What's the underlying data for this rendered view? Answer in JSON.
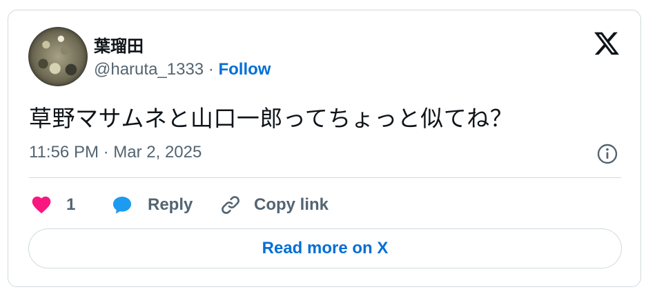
{
  "tweet": {
    "author": {
      "display_name": "葉瑠田",
      "handle": "@haruta_1333",
      "separator": " · ",
      "follow_label": "Follow"
    },
    "text": "草野マサムネと山口一郎ってちょっと似てね？",
    "timestamp": "11:56 PM · Mar 2, 2025",
    "actions": {
      "like_count": "1",
      "reply_label": "Reply",
      "copy_link_label": "Copy link"
    },
    "read_more_label": "Read more on X"
  },
  "icons": {
    "brand_logo": "x-logo-icon",
    "info": "info-icon",
    "like": "heart-icon",
    "reply": "speech-bubble-icon",
    "copy_link": "link-icon"
  },
  "colors": {
    "text_primary": "#0f1419",
    "text_secondary": "#536471",
    "link_blue": "#006fd6",
    "like_pink": "#f91880",
    "reply_blue": "#1d9bf0",
    "border": "#cfd9de"
  }
}
